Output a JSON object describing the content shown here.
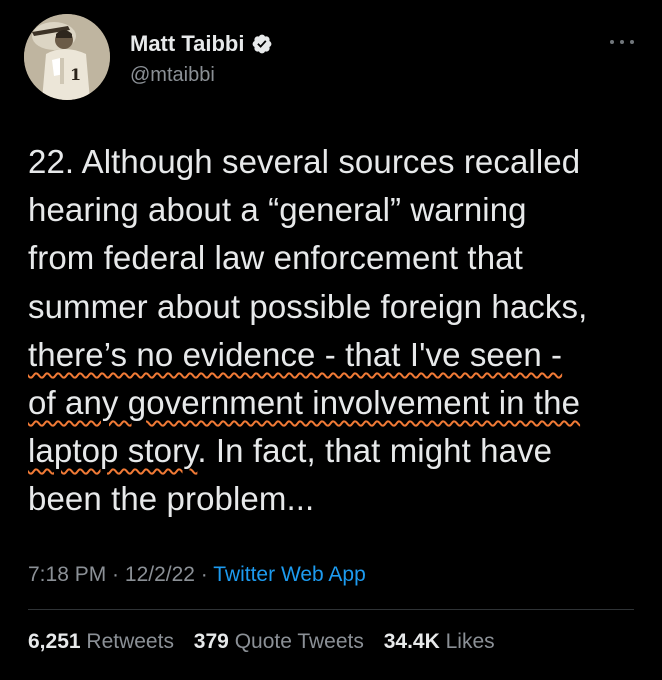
{
  "author": {
    "display_name": "Matt Taibbi",
    "handle": "@mtaibbi",
    "verified": true,
    "avatar_icon": "baseball-player-photo"
  },
  "tweet": {
    "lines": [
      "22. Although several sources recalled",
      "hearing about a “general” warning",
      "from federal law enforcement that",
      "summer about possible foreign hacks,"
    ],
    "highlighted": [
      "there’s no evidence - that I've seen -",
      "of any government involvement in the",
      "laptop story"
    ],
    "tail": [
      ". In fact, that might have",
      "been the problem..."
    ]
  },
  "meta": {
    "time": "7:18 PM",
    "sep1": " · ",
    "date": "12/2/22",
    "sep2": " · ",
    "source": "Twitter Web App"
  },
  "stats": {
    "retweets_count": "6,251",
    "retweets_label": "Retweets",
    "quotes_count": "379",
    "quotes_label": "Quote Tweets",
    "likes_count": "34.4K",
    "likes_label": "Likes"
  },
  "colors": {
    "background": "#000000",
    "text": "#e7e9ea",
    "secondary": "#8b9096",
    "link": "#1d9bf0",
    "highlight_underline": "#f07a36"
  }
}
